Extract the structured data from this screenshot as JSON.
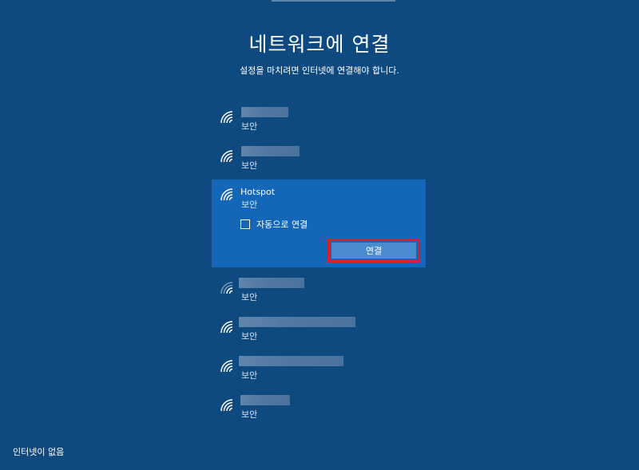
{
  "page": {
    "title": "네트워크에 연결",
    "subtitle": "설정을 마치려면 인터넷에 연결해야 합니다."
  },
  "networks": [
    {
      "security": "보안"
    },
    {
      "security": "보안"
    },
    {
      "name": "Hotspot",
      "security": "보안",
      "auto_connect_label": "자동으로 연결",
      "connect_label": "연결",
      "auto_connect": false
    },
    {
      "security": "보안"
    },
    {
      "security": "보안"
    },
    {
      "security": "보안"
    },
    {
      "security": "보안"
    }
  ],
  "icons": {
    "wifi": "wifi-signal-icon",
    "checkbox": "checkbox-icon"
  },
  "colors": {
    "background": "#0e4a80",
    "selected_item": "#1467b8",
    "connect_button": "#4a8cd0",
    "highlight_border": "#e01e26"
  },
  "footer": {
    "status": "인터넷이 없음"
  }
}
